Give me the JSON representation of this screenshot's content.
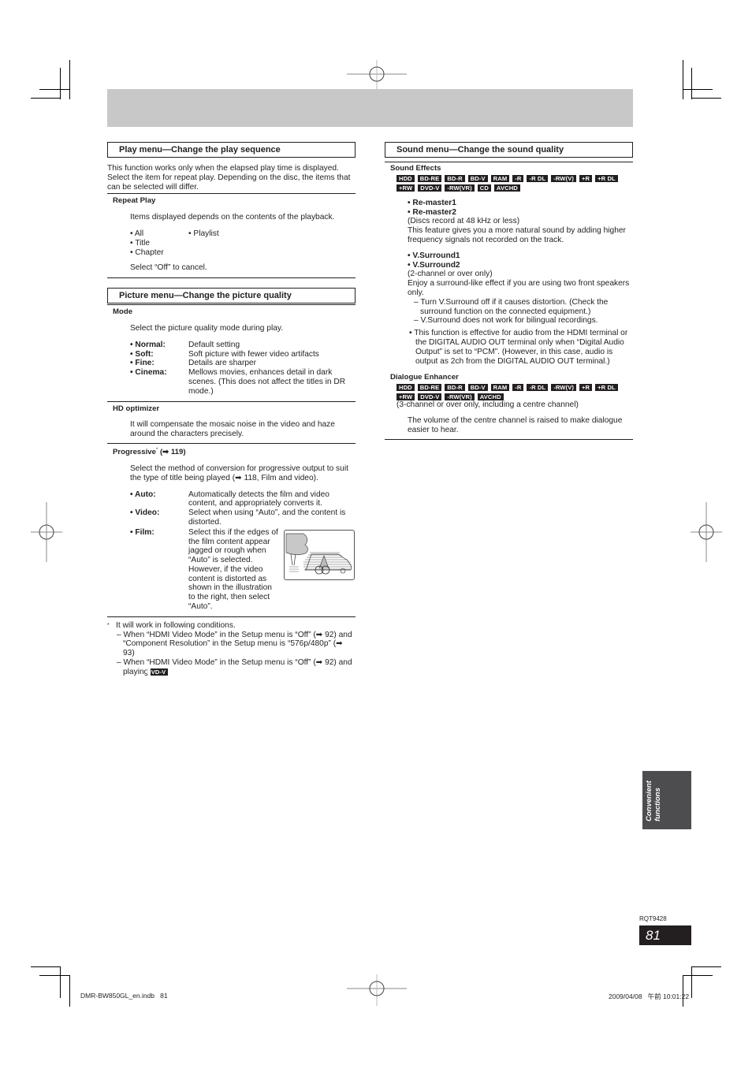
{
  "play_menu": {
    "title": "Play menu—Change the play sequence",
    "intro": "This function works only when the elapsed play time is displayed. Select the item for repeat play. Depending on the disc, the items that can be selected will differ.",
    "repeat_play": {
      "heading": "Repeat Play",
      "desc": "Items displayed depends on the contents of the playback.",
      "options_col1": [
        "All",
        "Title",
        "Chapter"
      ],
      "options_col2": [
        "Playlist"
      ],
      "cancel_note": "Select “Off” to cancel."
    }
  },
  "picture_menu": {
    "title": "Picture menu—Change the picture quality",
    "mode": {
      "heading": "Mode",
      "desc": "Select the picture quality mode during play.",
      "items": [
        {
          "key": "Normal:",
          "value": "Default setting"
        },
        {
          "key": "Soft:",
          "value": "Soft picture with fewer video artifacts"
        },
        {
          "key": "Fine:",
          "value": "Details are sharper"
        },
        {
          "key": "Cinema:",
          "value": "Mellows movies, enhances detail in dark scenes. (This does not affect the titles in DR mode.)"
        }
      ]
    },
    "hd_optimizer": {
      "heading": "HD optimizer",
      "desc": "It will compensate the mosaic noise in the video and haze around the characters precisely."
    },
    "progressive": {
      "heading": "Progressive",
      "heading_mark": "*",
      "heading_ref": "(➡ 119)",
      "desc": "Select the method of conversion for progressive output to suit the type of title being played (➡ 118, Film and video).",
      "items": [
        {
          "key": "Auto:",
          "value": "Automatically detects the film and video content, and appropriately converts it."
        },
        {
          "key": "Video:",
          "value": "Select when using “Auto”, and the content is distorted."
        },
        {
          "key": "Film:",
          "value": "Select this if the edges of the film content appear jagged or rough when “Auto” is selected. However, if the video content is distorted as shown in the illustration to the right, then select “Auto”."
        }
      ],
      "illustration": "distorted-car-and-tree-illustration"
    },
    "footnote": {
      "mark": "*",
      "intro": "It will work in following conditions.",
      "conditions": [
        "When “HDMI Video Mode” in the Setup menu is “Off” (➡ 92) and “Component Resolution” in the Setup menu is “576p/480p” (➡ 93)",
        "When “HDMI Video Mode” in the Setup menu is “Off” (➡ 92) and playing"
      ],
      "badge": "DVD-V"
    }
  },
  "sound_menu": {
    "title": "Sound menu—Change the sound quality",
    "sound_effects": {
      "heading": "Sound Effects",
      "badges": [
        "HDD",
        "BD-RE",
        "BD-R",
        "BD-V",
        "RAM",
        "-R",
        "-R DL",
        "-RW(V)",
        "+R",
        "+R DL",
        "+RW",
        "DVD-V",
        "-RW(VR)",
        "CD",
        "AVCHD"
      ],
      "remaster": {
        "items": [
          "Re-master1",
          "Re-master2"
        ],
        "note": "(Discs record at 48 kHz or less)",
        "desc": "This feature gives you a more natural sound by adding higher frequency signals not recorded on the track."
      },
      "surround": {
        "items": [
          "V.Surround1",
          "V.Surround2"
        ],
        "note": "(2-channel or over only)",
        "desc": "Enjoy a surround-like effect if you are using two front speakers only.",
        "dashes": [
          "Turn V.Surround off if it causes distortion. (Check the surround function on the connected equipment.)",
          "V.Surround does not work for bilingual recordings."
        ],
        "bullet_note": "This function is effective for audio from the HDMI terminal or the DIGITAL AUDIO OUT terminal only when “Digital Audio Output” is set to “PCM”. (However, in this case, audio is output as 2ch from the DIGITAL AUDIO OUT terminal.)"
      }
    },
    "dialogue_enhancer": {
      "heading": "Dialogue Enhancer",
      "badges": [
        "HDD",
        "BD-RE",
        "BD-R",
        "BD-V",
        "RAM",
        "-R",
        "-R DL",
        "-RW(V)",
        "+R",
        "+R DL",
        "+RW",
        "DVD-V",
        "-RW(VR)",
        "AVCHD"
      ],
      "note": "(3-channel or over only, including a centre channel)",
      "desc": "The volume of the centre channel is raised to make dialogue easier to hear."
    }
  },
  "side_tab": {
    "label": "Convenient\nfunctions"
  },
  "page": {
    "code": "RQT9428",
    "number": "81"
  },
  "footer": {
    "file": "DMR-BW850GL_en.indb   81",
    "timestamp": "2009/04/08   午前 10:01:22"
  }
}
